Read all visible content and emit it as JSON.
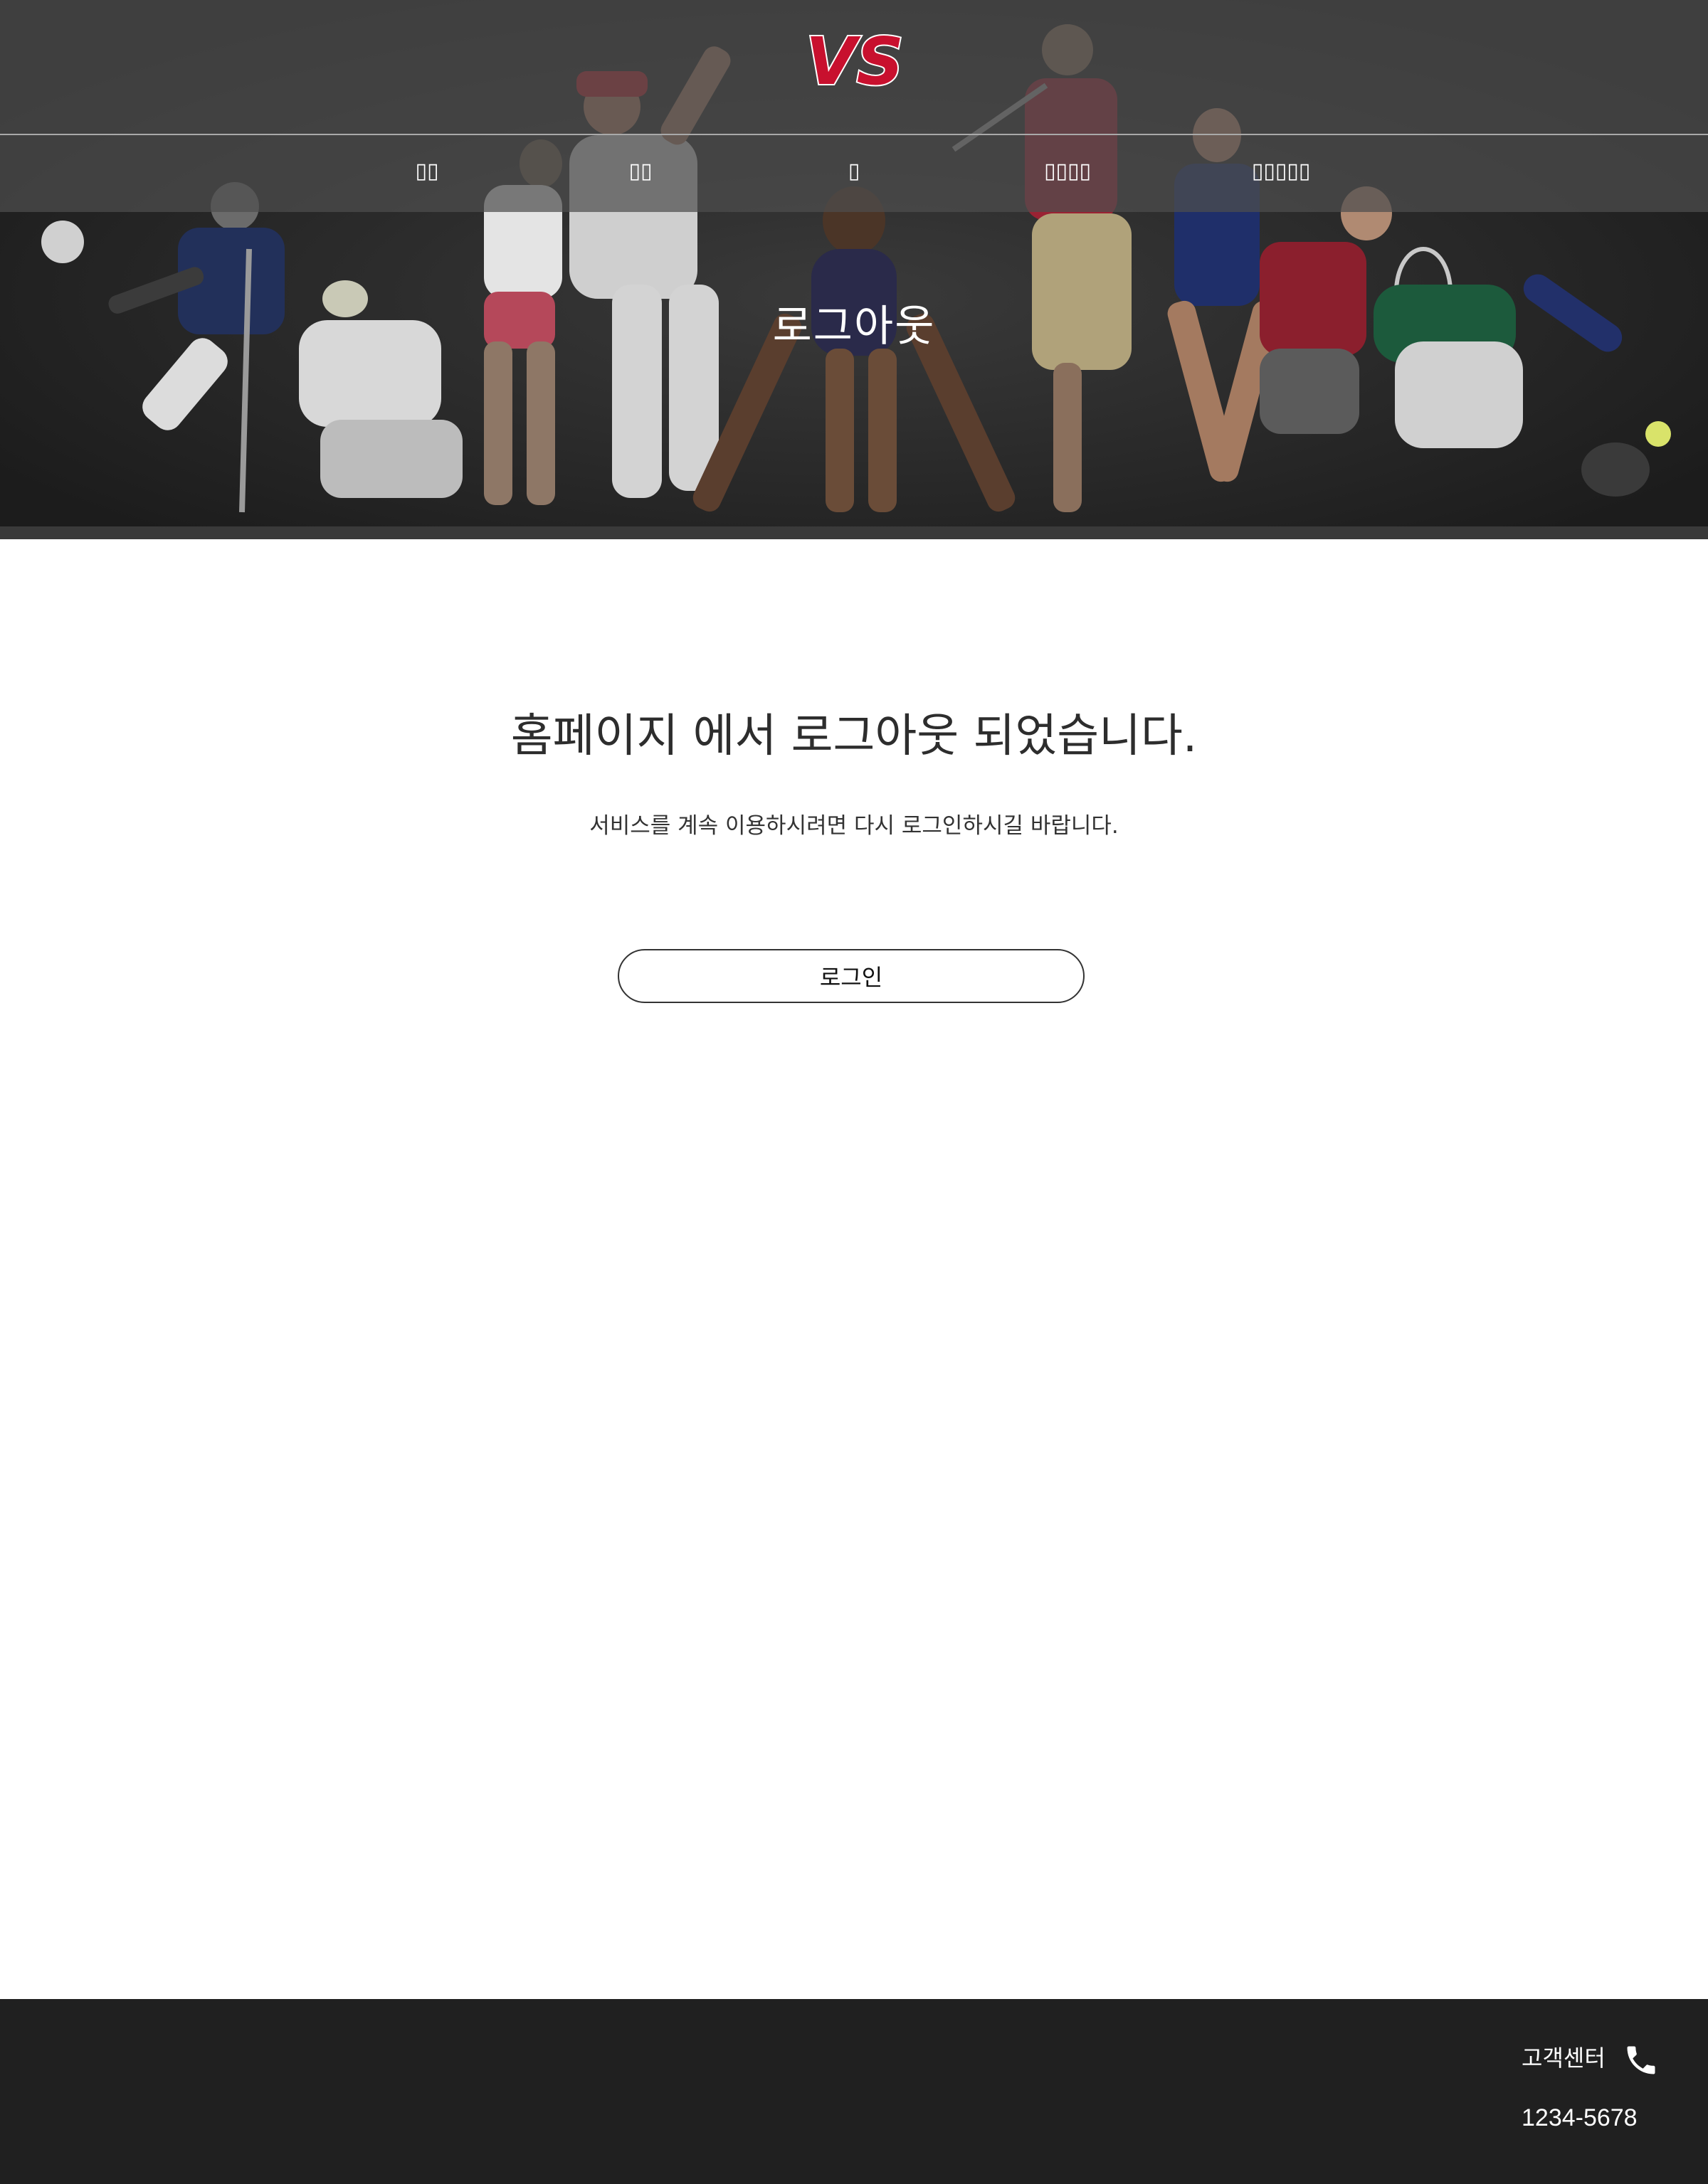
{
  "header": {
    "logo_text": "VS",
    "nav": [
      {
        "label": "▯▯"
      },
      {
        "label": "▯▯"
      },
      {
        "label": "▯"
      },
      {
        "label": "▯▯▯▯"
      },
      {
        "label": "▯▯▯▯▯"
      }
    ]
  },
  "hero": {
    "title": "로그아웃"
  },
  "main": {
    "heading": "홈페이지 에서 로그아웃 되었습니다.",
    "subtext": "서비스를 계속 이용하시려면 다시 로그인하시길 바랍니다.",
    "login_button": "로그인"
  },
  "footer": {
    "cs_label": "고객센터",
    "cs_icon": "phone-icon",
    "cs_number": "1234-5678"
  },
  "colors": {
    "hero_bg": "#1f1f1f",
    "topbar": "#4e4e4e",
    "footer_bg": "#202020",
    "logo_red": "#c8102e"
  }
}
